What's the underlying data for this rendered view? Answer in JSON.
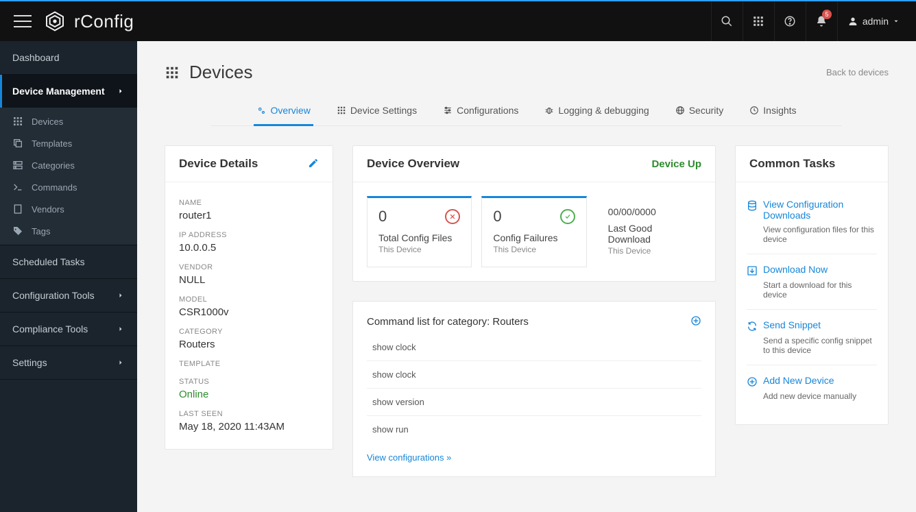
{
  "brand": "rConfig",
  "user": {
    "name": "admin"
  },
  "notifications": {
    "count": "5"
  },
  "page": {
    "title": "Devices",
    "back_link": "Back to devices"
  },
  "sidebar": {
    "dashboard": "Dashboard",
    "device_mgmt": "Device Management",
    "subitems": [
      "Devices",
      "Templates",
      "Categories",
      "Commands",
      "Vendors",
      "Tags"
    ],
    "scheduled": "Scheduled Tasks",
    "config_tools": "Configuration Tools",
    "compliance_tools": "Compliance Tools",
    "settings": "Settings"
  },
  "tabs": {
    "overview": "Overview",
    "device_settings": "Device Settings",
    "configurations": "Configurations",
    "logging": "Logging & debugging",
    "security": "Security",
    "insights": "Insights"
  },
  "details": {
    "card_title": "Device Details",
    "name_label": "NAME",
    "name_value": "router1",
    "ip_label": "IP ADDRESS",
    "ip_value": "10.0.0.5",
    "vendor_label": "VENDOR",
    "vendor_value": "NULL",
    "model_label": "MODEL",
    "model_value": "CSR1000v",
    "category_label": "CATEGORY",
    "category_value": "Routers",
    "template_label": "TEMPLATE",
    "template_value": "",
    "status_label": "STATUS",
    "status_value": "Online",
    "last_seen_label": "LAST SEEN",
    "last_seen_value": "May 18, 2020 11:43AM"
  },
  "overview": {
    "card_title": "Device Overview",
    "status_text": "Device Up",
    "stats": [
      {
        "big": "0",
        "title": "Total Config Files",
        "sub": "This Device"
      },
      {
        "big": "0",
        "title": "Config Failures",
        "sub": "This Device"
      },
      {
        "date": "00/00/0000",
        "title": "Last Good Download",
        "sub": "This Device"
      }
    ]
  },
  "commands": {
    "card_title": "Command list for category: Routers",
    "list": [
      "show clock",
      "show clock",
      "show version",
      "show run"
    ],
    "view_link": "View configurations »"
  },
  "tasks": {
    "card_title": "Common Tasks",
    "items": [
      {
        "title": "View Configuration Downloads",
        "desc": "View configuration files for this device"
      },
      {
        "title": "Download Now",
        "desc": "Start a download for this device"
      },
      {
        "title": "Send Snippet",
        "desc": "Send a specific config snippet to this device"
      },
      {
        "title": "Add New Device",
        "desc": "Add new device manually"
      }
    ]
  }
}
